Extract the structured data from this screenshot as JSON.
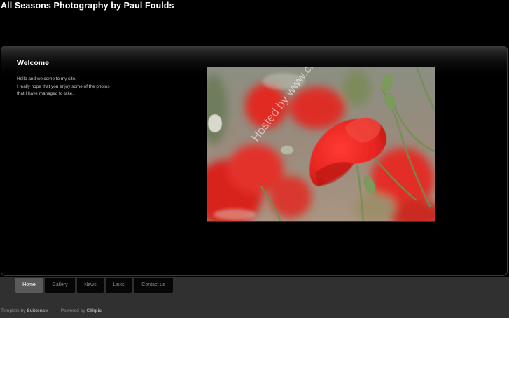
{
  "site": {
    "title": "All Seasons Photography by Paul Foulds"
  },
  "main": {
    "heading": "Welcome",
    "intro_lines": [
      "Hello and welcome to my site.",
      "I really hope that you enjoy some of the photos",
      "that I have managed to take."
    ],
    "photo": {
      "subject": "red-poppy-photo",
      "watermark": "Hosted by www.clikpic.com"
    }
  },
  "nav": {
    "items": [
      {
        "label": "Home",
        "active": true
      },
      {
        "label": "Gallery",
        "active": false
      },
      {
        "label": "News",
        "active": false
      },
      {
        "label": "Links",
        "active": false
      },
      {
        "label": "Contact us",
        "active": false
      }
    ]
  },
  "footer": {
    "template_prefix": "Template by",
    "template_link": "Subtense",
    "powered_prefix": "Powered by",
    "powered_link": "Clikpic"
  },
  "colors": {
    "background": "#000000",
    "band": "#303030",
    "active_tab": "#5a5a5a",
    "poppy": "#e8322c"
  }
}
